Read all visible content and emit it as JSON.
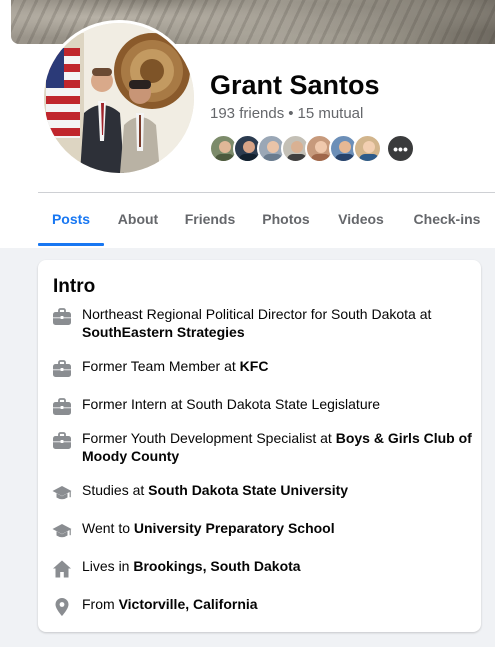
{
  "profile": {
    "name": "Grant Santos",
    "friends_count": "193 friends",
    "mutual_count": "15 mutual",
    "separator": "•",
    "more_friends_glyph": "•••"
  },
  "tabs": [
    {
      "label": "Posts",
      "active": true
    },
    {
      "label": "About",
      "active": false
    },
    {
      "label": "Friends",
      "active": false
    },
    {
      "label": "Photos",
      "active": false
    },
    {
      "label": "Videos",
      "active": false
    },
    {
      "label": "Check-ins",
      "active": false
    }
  ],
  "intro": {
    "title": "Intro",
    "items": [
      {
        "icon": "briefcase-icon",
        "prefix": "Northeast Regional Political Director for South Dakota at ",
        "bold": "SouthEastern Strategies"
      },
      {
        "icon": "briefcase-icon",
        "prefix": "Former Team Member at ",
        "bold": "KFC"
      },
      {
        "icon": "briefcase-icon",
        "prefix": "Former Intern at South Dakota State Legislature",
        "bold": ""
      },
      {
        "icon": "briefcase-icon",
        "prefix": "Former Youth Development Specialist at ",
        "bold": "Boys & Girls Club of Moody County"
      },
      {
        "icon": "graduation-cap-icon",
        "prefix": "Studies at ",
        "bold": "South Dakota State University"
      },
      {
        "icon": "graduation-cap-icon",
        "prefix": "Went to ",
        "bold": "University Preparatory School"
      },
      {
        "icon": "home-icon",
        "prefix": "Lives in ",
        "bold": "Brookings, South Dakota"
      },
      {
        "icon": "location-pin-icon",
        "prefix": "From ",
        "bold": "Victorville, California"
      }
    ]
  },
  "colors": {
    "accent": "#1877f2",
    "secondary_text": "#65676b",
    "icon_gray": "#8a8d91",
    "page_bg": "#f0f2f5"
  }
}
